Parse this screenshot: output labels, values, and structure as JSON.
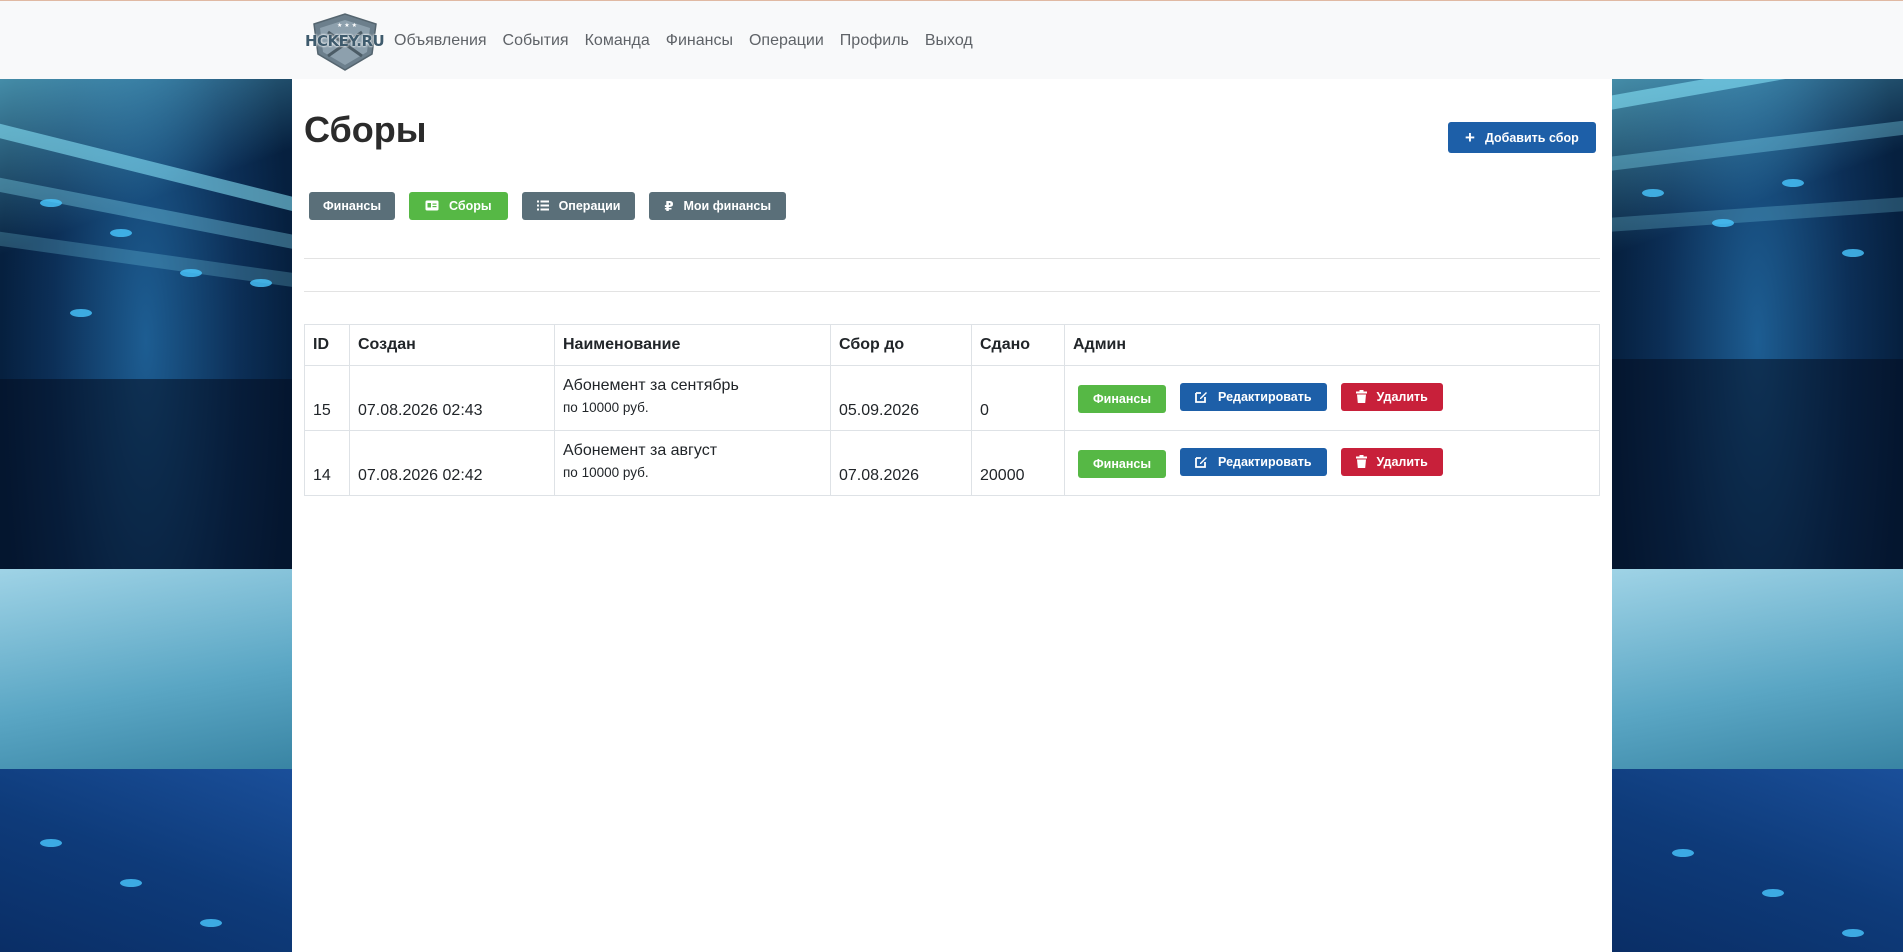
{
  "nav": {
    "brand_text": "HCKEY.RU",
    "links": [
      "Объявления",
      "События",
      "Команда",
      "Финансы",
      "Операции",
      "Профиль",
      "Выход"
    ]
  },
  "page": {
    "title": "Сборы",
    "add_button": "Добавить сбор"
  },
  "subnav": {
    "finances": "Финансы",
    "collections": "Сборы",
    "operations": "Операции",
    "my_finances": "Мои финансы"
  },
  "table": {
    "headers": [
      "ID",
      "Создан",
      "Наименование",
      "Сбор до",
      "Сдано",
      "Админ"
    ],
    "rows": [
      {
        "id": "15",
        "created": "07.08.2026 02:43",
        "name": "Абонемент за сентябрь",
        "sub": "по 10000 руб.",
        "due": "05.09.2026",
        "paid": "0"
      },
      {
        "id": "14",
        "created": "07.08.2026 02:42",
        "name": "Абонемент за август",
        "sub": "по 10000 руб.",
        "due": "07.08.2026",
        "paid": "20000"
      }
    ],
    "actions": {
      "finances": "Финансы",
      "edit": "Редактировать",
      "delete": "Удалить"
    }
  },
  "colors": {
    "primary": "#1d5fa8",
    "success": "#56b845",
    "danger": "#c8203a",
    "secondary": "#5a6f79"
  },
  "icons": {
    "add": "plus-icon",
    "collections": "id-card-icon",
    "operations": "list-icon",
    "my_finances": "ruble-icon",
    "edit": "edit-icon",
    "delete": "trash-icon"
  }
}
